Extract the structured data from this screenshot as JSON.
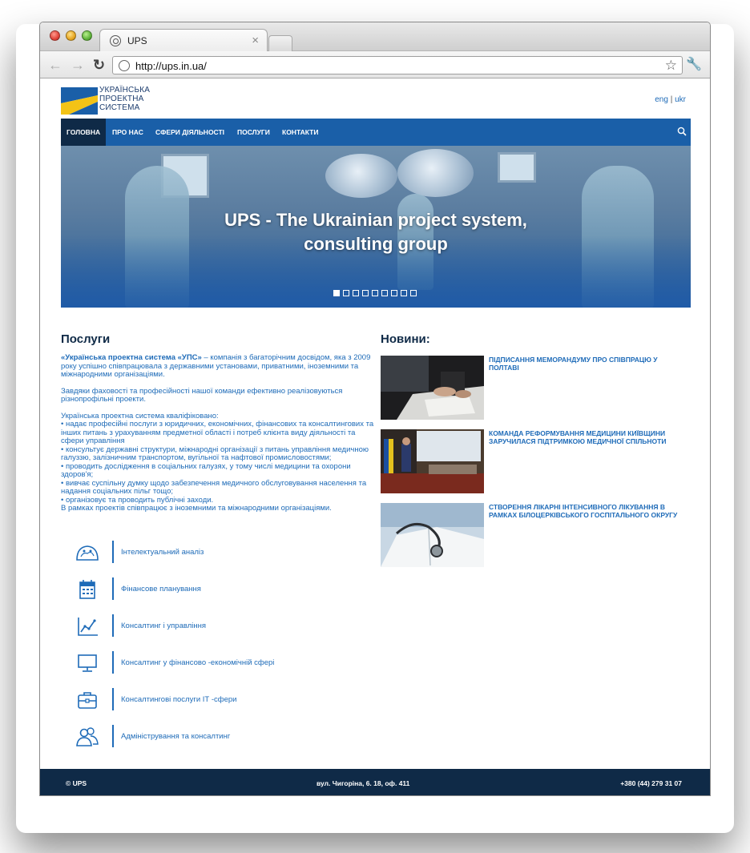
{
  "browser": {
    "tab_title": "UPS",
    "tab_close": "×",
    "url": "http://ups.in.ua/"
  },
  "header": {
    "logo_lines": [
      "УКРАЇНСЬКА",
      "ПРОЕКТНА",
      "СИСТЕМА"
    ],
    "lang_eng": "eng",
    "lang_sep": "|",
    "lang_ukr": "ukr"
  },
  "nav": {
    "items": [
      {
        "label": "ГОЛОВНА",
        "active": true
      },
      {
        "label": "ПРО НАС",
        "active": false
      },
      {
        "label": "СФЕРИ ДІЯЛЬНОСТІ",
        "active": false
      },
      {
        "label": "ПОСЛУГИ",
        "active": false
      },
      {
        "label": "КОНТАКТИ",
        "active": false
      }
    ]
  },
  "hero": {
    "line1": "UPS - The Ukrainian project system,",
    "line2": "consulting group",
    "slides_total": 9,
    "slide_active": 1
  },
  "services": {
    "title": "Послуги",
    "intro_brand": "«Українська проектна система «УПС»",
    "intro_rest": " – компанія з багаторічним досвідом, яка з 2009 року успішно співпрацювала з державними установами, приватними, іноземними та міжнародними організаціями.",
    "para2": "Завдяки фаховості та професійності нашої команди ефективно реалізовуються різнопрофільні проекти.",
    "para3_lines": [
      "Українська проектна система кваліфіковано:",
      "• надає професійні послуги з юридичних, економічних, фінансових та консалтингових та інших питань з урахуванням предметної області і потреб клієнта виду діяльності та сфери управління",
      "• консультує державні структури, міжнародні організації з питань управління медичною галуззю, залізничним транспортом, вугільної та нафтової промисловостями;",
      "• проводить дослідження в соціальних галузях, у тому числі медицини та охорони здоров'я;",
      "• вивчає суспільну думку щодо забезпечення медичного обслуговування населення та надання соціальних пільг тощо;",
      "• організовує та проводить публічні заходи.",
      "В рамках проектів співпрацює з іноземними та міжнародними організаціями."
    ],
    "items": [
      {
        "label": "Інтелектуальний аналіз",
        "icon": "brain-icon"
      },
      {
        "label": "Фінансове планування",
        "icon": "calendar-icon"
      },
      {
        "label": "Консалтинг і управління",
        "icon": "line-chart-icon"
      },
      {
        "label": "Консалтинг у фінансово -економічній сфері",
        "icon": "monitor-icon"
      },
      {
        "label": "Консалтингові послуги ІТ -сфери",
        "icon": "briefcase-icon"
      },
      {
        "label": "Адміністрування та консалтинг",
        "icon": "users-icon"
      }
    ]
  },
  "news": {
    "title": "Новини:",
    "items": [
      {
        "headline": "ПІДПИСАННЯ МЕМОРАНДУМУ ПРО СПІВПРАЦЮ У ПОЛТАВІ"
      },
      {
        "headline": "КОМАНДА РЕФОРМУВАННЯ МЕДИЦИНИ КИЇВЩИНИ ЗАРУЧИЛАСЯ ПІДТРИМКОЮ МЕДИЧНОЇ СПІЛЬНОТИ"
      },
      {
        "headline": "СТВОРЕННЯ ЛІКАРНІ ІНТЕНСИВНОГО ЛІКУВАННЯ В РАМКАХ БІЛОЦЕРКІВСЬКОГО ГОСПІТАЛЬНОГО ОКРУГУ"
      }
    ]
  },
  "footer": {
    "copyright": "© UPS",
    "address": "вул. Чигоріна, 6. 18, оф. 411",
    "phone": "+380 (44) 279 31 07"
  },
  "colors": {
    "brand_blue": "#1a5fa8",
    "dark_navy": "#0f2a47",
    "link_blue": "#1e6bb8"
  }
}
